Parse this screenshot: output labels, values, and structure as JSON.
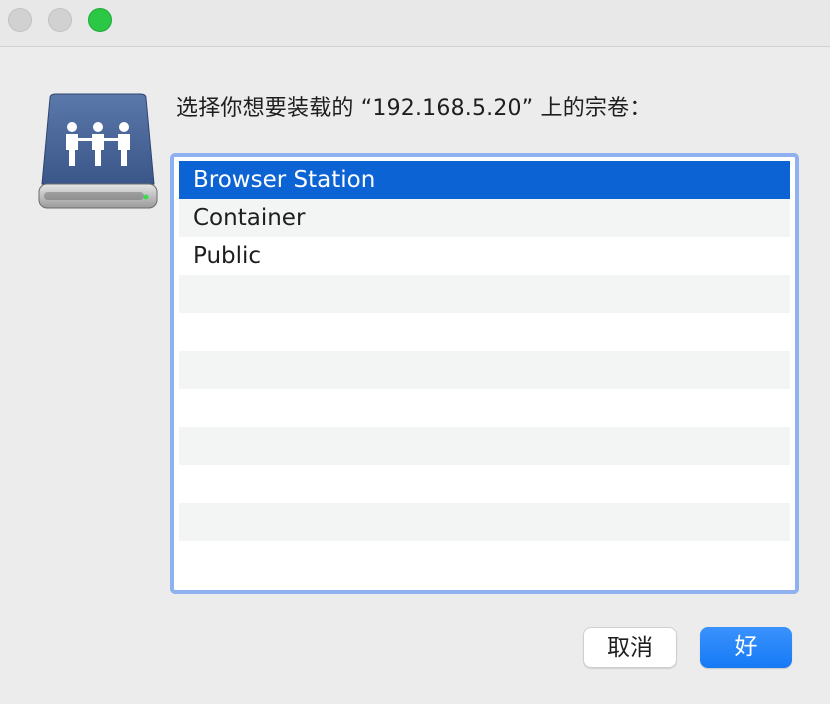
{
  "window": {
    "controls": [
      "close",
      "minimize",
      "zoom"
    ],
    "zoom_color": "#2ac845"
  },
  "dialog": {
    "icon": "shared-drive-icon",
    "prompt": "选择你想要装载的 “192.168.5.20” 上的宗卷：",
    "volumes": [
      {
        "label": "Browser Station",
        "selected": true
      },
      {
        "label": "Container",
        "selected": false
      },
      {
        "label": "Public",
        "selected": false
      },
      {
        "label": "",
        "selected": false
      },
      {
        "label": "",
        "selected": false
      },
      {
        "label": "",
        "selected": false
      },
      {
        "label": "",
        "selected": false
      },
      {
        "label": "",
        "selected": false
      },
      {
        "label": "",
        "selected": false
      },
      {
        "label": "",
        "selected": false
      },
      {
        "label": "",
        "selected": false
      }
    ],
    "buttons": {
      "cancel": "取消",
      "ok": "好"
    },
    "colors": {
      "selection": "#0b63d4",
      "focus_ring": "#8fb1ef",
      "default_button": "#167af6"
    }
  }
}
